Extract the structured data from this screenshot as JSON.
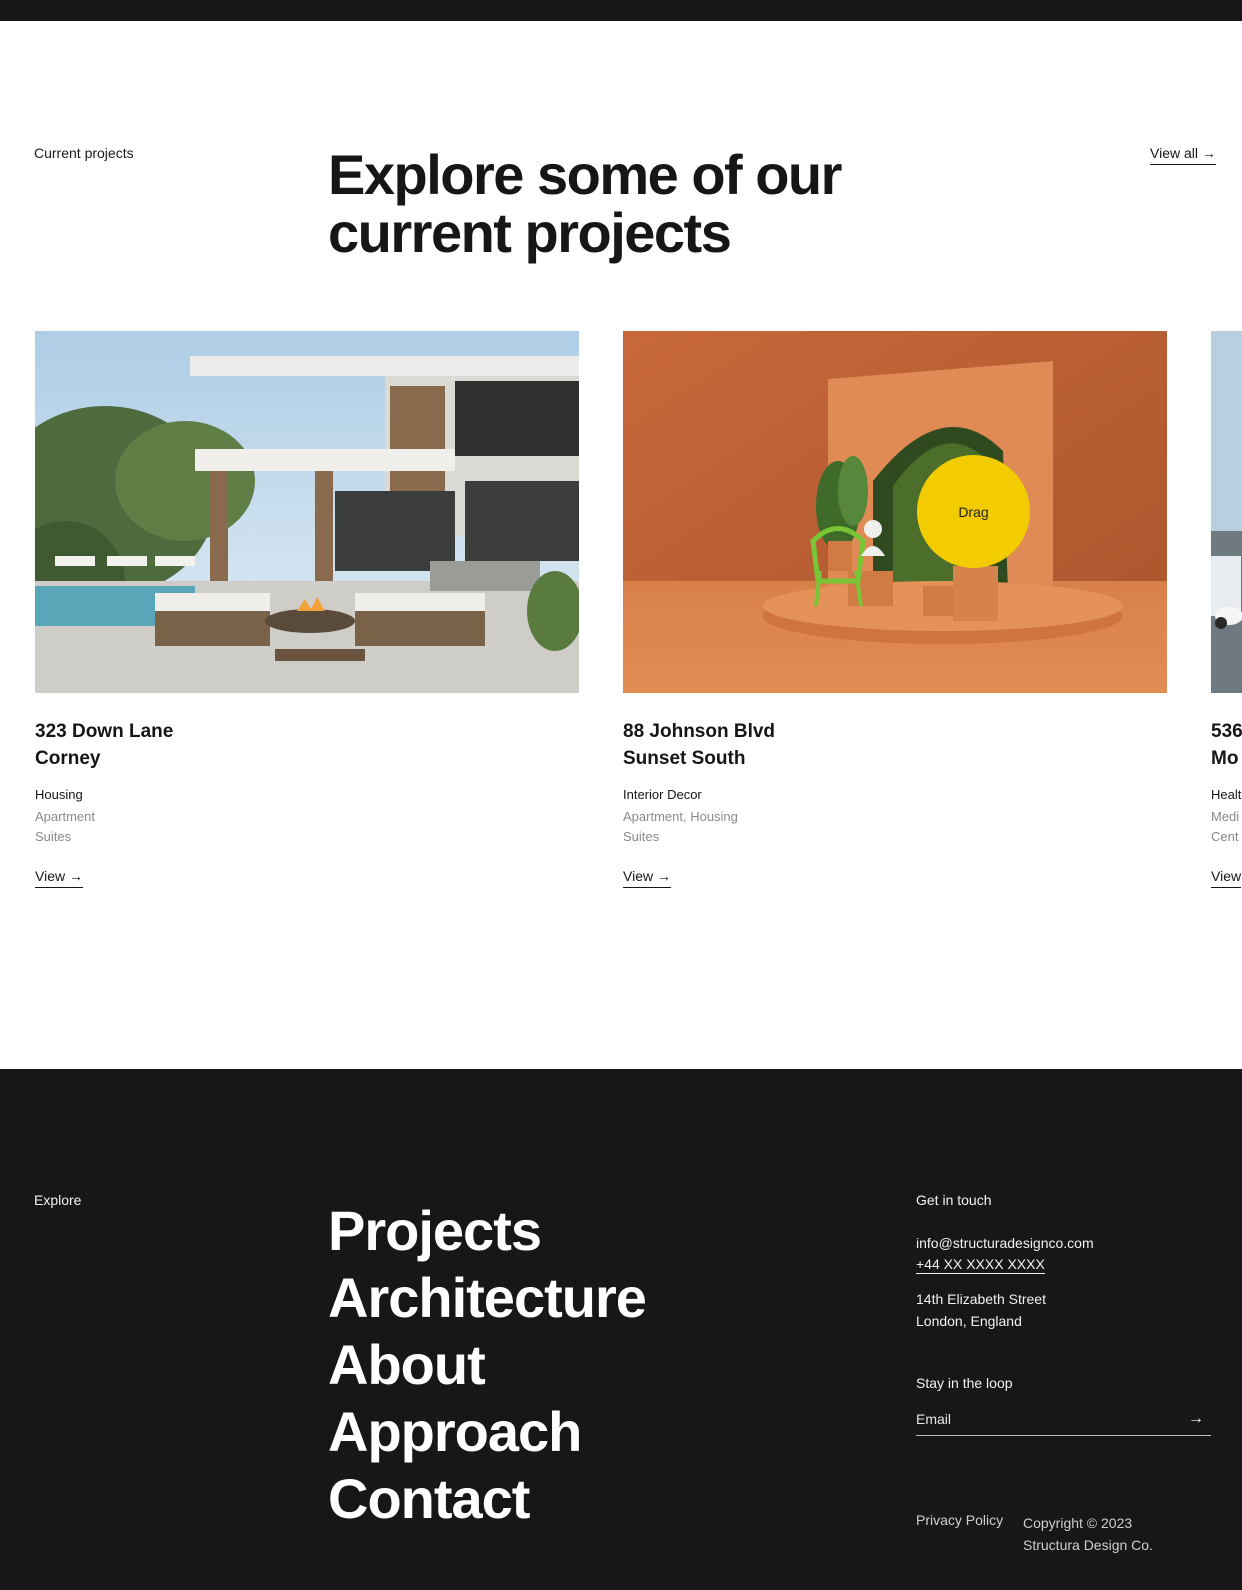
{
  "section": {
    "label": "Current projects",
    "headline": "Explore some of our current projects",
    "view_all": "View all →"
  },
  "projects": [
    {
      "address_line1": "323 Down Lane",
      "address_line2": "Corney",
      "category": "Housing",
      "tags_line1": "Apartment",
      "tags_line2": "Suites",
      "view": "View →"
    },
    {
      "address_line1": "88 Johnson Blvd",
      "address_line2": "Sunset South",
      "category": "Interior Decor",
      "tags_line1": "Apartment, Housing",
      "tags_line2": "Suites",
      "view": "View →"
    },
    {
      "address_line1": "536",
      "address_line2": "Mo",
      "category": "Healt",
      "tags_line1": "Medi",
      "tags_line2": "Cent",
      "view": "View"
    }
  ],
  "drag_cursor": {
    "label": "Drag",
    "color": "#f2cc00"
  },
  "footer": {
    "explore_label": "Explore",
    "nav": [
      "Projects",
      "Architecture",
      "About",
      "Approach",
      "Contact"
    ],
    "contact": {
      "title": "Get in touch",
      "email": "info@structuradesignco.com",
      "phone": "+44 XX XXXX XXXX",
      "address_line1": "14th Elizabeth Street",
      "address_line2": "London, England"
    },
    "newsletter": {
      "title": "Stay in the loop",
      "placeholder": "Email",
      "submit_icon": "arrow-right-icon"
    },
    "privacy": "Privacy Policy",
    "copyright_line1": "Copyright © 2023",
    "copyright_line2": "Structura Design Co."
  },
  "colors": {
    "dark": "#161616",
    "accent_yellow": "#f2cc00",
    "muted_text": "#8a8a8a"
  }
}
